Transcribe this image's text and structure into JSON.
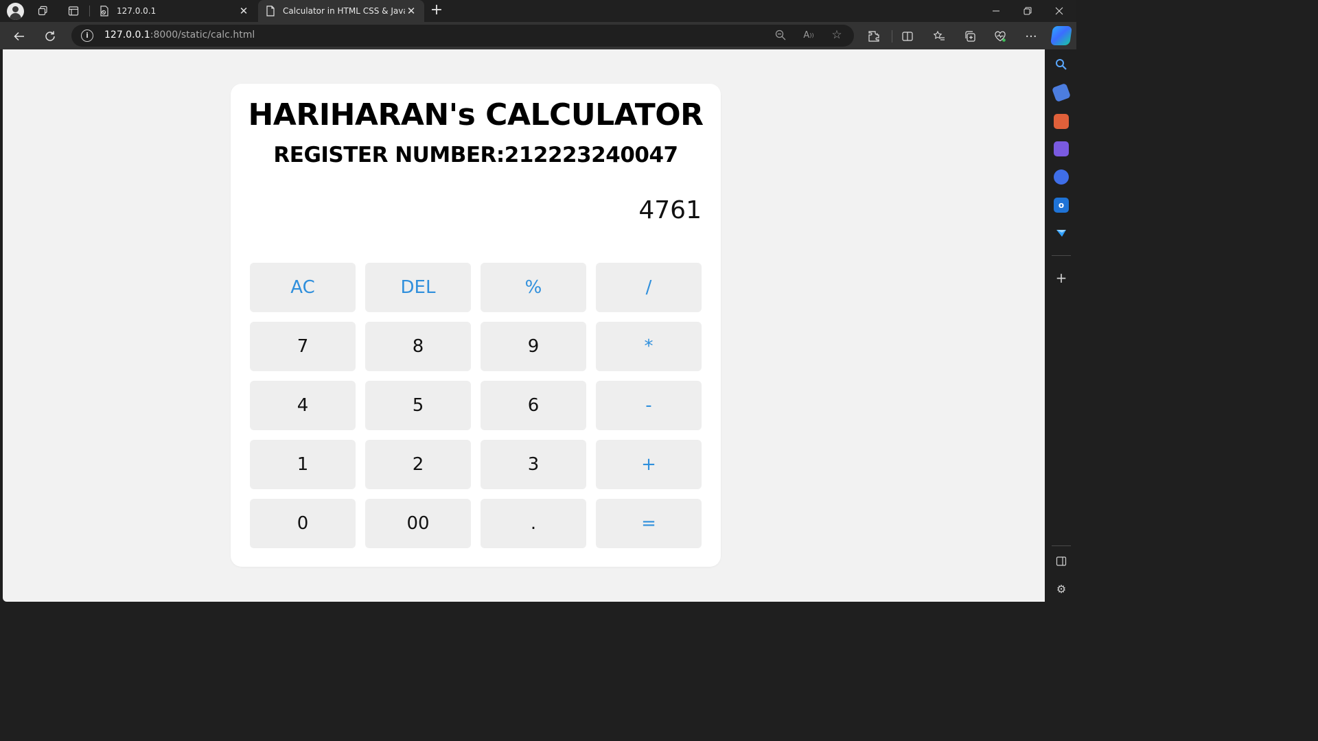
{
  "browser": {
    "tabs": [
      {
        "title": "127.0.0.1",
        "active": false
      },
      {
        "title": "Calculator in HTML CSS & JavaScript",
        "active": true
      }
    ],
    "address": {
      "host": "127.0.0.1",
      "rest": ":8000/static/calc.html"
    }
  },
  "page": {
    "title": "HARIHARAN's CALCULATOR",
    "register": "REGISTER NUMBER:212223240047",
    "display_value": "4761",
    "keys": {
      "ac": "AC",
      "del": "DEL",
      "percent": "%",
      "divide": "/",
      "seven": "7",
      "eight": "8",
      "nine": "9",
      "multiply": "*",
      "four": "4",
      "five": "5",
      "six": "6",
      "minus": "-",
      "one": "1",
      "two": "2",
      "three": "3",
      "plus": "+",
      "zero": "0",
      "double_zero": "00",
      "dot": ".",
      "equals": "="
    }
  },
  "colors": {
    "operator_text": "#2f8fdc",
    "key_bg": "#eeeeee",
    "page_bg": "#f2f2f2"
  }
}
